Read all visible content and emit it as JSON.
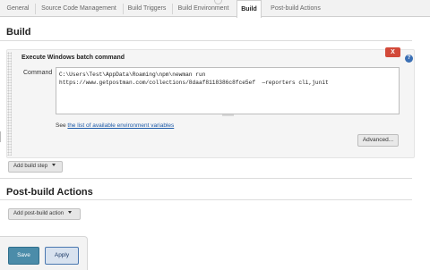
{
  "tabs": [
    {
      "label": "General"
    },
    {
      "label": "Source Code Management"
    },
    {
      "label": "Build Triggers"
    },
    {
      "label": "Build Environment"
    },
    {
      "label": "Build"
    },
    {
      "label": "Post-build Actions"
    }
  ],
  "build": {
    "title": "Build",
    "step": {
      "title": "Execute Windows batch command",
      "delete_label": "X",
      "help_label": "?",
      "command_label": "Command",
      "command_value": "C:\\Users\\Test\\AppData\\Roaming\\npm\\newman run\nhttps://www.getpostman.com/collections/8daaf8118386c8fce5ef  —reporters cli,junit",
      "env_prefix": "See",
      "env_link": "the list of available environment variables",
      "advanced_label": "Advanced..."
    },
    "add_step_label": "Add build step"
  },
  "post_build": {
    "title": "Post-build Actions",
    "add_action_label": "Add post-build action"
  },
  "footer": {
    "save_label": "Save",
    "apply_label": "Apply"
  }
}
